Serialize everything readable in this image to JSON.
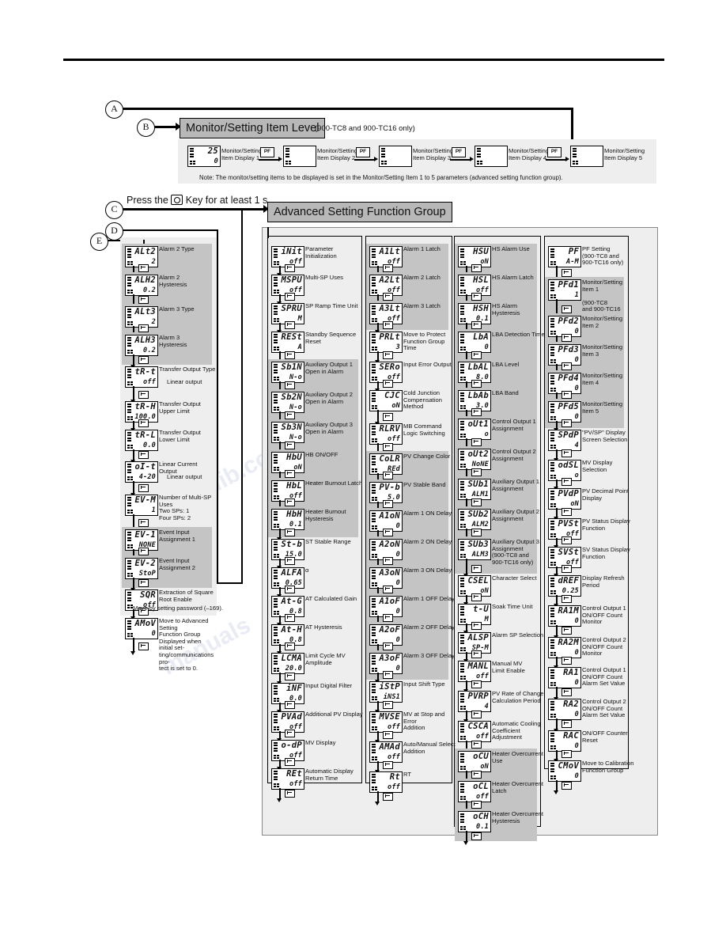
{
  "markers": {
    "a": "A",
    "b": "B",
    "c": "C",
    "d": "D",
    "e": "E"
  },
  "headings": {
    "monitor_level": "Monitor/Setting Item Level",
    "monitor_level_note": "(900-TC8 and 900-TC16 only)",
    "advanced_group": "Advanced Setting Function Group"
  },
  "press_instruction": {
    "pre": "Press the",
    "post": "Key for at least 1 s."
  },
  "monitor_strip": {
    "items": [
      {
        "label": "Monitor/Setting\nItem Display 1",
        "t1": "25",
        "t2": "0"
      },
      {
        "label": "Monitor/Setting\nItem Display 2",
        "t1": "",
        "t2": ""
      },
      {
        "label": "Monitor/Setting\nItem Display 3",
        "t1": "",
        "t2": ""
      },
      {
        "label": "Monitor/Setting\nItem Display 4",
        "t1": "",
        "t2": ""
      },
      {
        "label": "Monitor/Setting\nItem Display 5",
        "t1": "",
        "t2": ""
      }
    ],
    "key_label": "PF",
    "note": "Note: The monitor/setting items to be displayed is set in the Monitor/Setting Item 1 to 5 parameters (advanced setting function group)."
  },
  "column_e": {
    "password_note": "Move by setting password (–169).",
    "items": [
      {
        "t1": "ALt2",
        "t2": "2",
        "label": "Alarm 2 Type",
        "shaded": true
      },
      {
        "t1": "ALH2",
        "t2": "0.2",
        "label": "Alarm 2\nHysteresis",
        "shaded": true
      },
      {
        "t1": "ALt3",
        "t2": "2",
        "label": "Alarm 3 Type",
        "shaded": true
      },
      {
        "t1": "ALH3",
        "t2": "0.2",
        "label": "Alarm 3\nHysteresis",
        "shaded": true
      },
      {
        "t1": "tR-t",
        "t2": "off",
        "label": "Transfer Output Type",
        "extra": "Linear output",
        "shaded": false
      },
      {
        "t1": "tR-H",
        "t2": "100.0",
        "label": "Transfer Output\nUpper Limit",
        "shaded": false
      },
      {
        "t1": "tR-L",
        "t2": "0.0",
        "label": "Transfer Output\nLower Limit",
        "shaded": false
      },
      {
        "t1": "oI-t",
        "t2": "4-20",
        "label": "Linear Current Output",
        "extra": "Linear output",
        "shaded": false
      },
      {
        "t1": "EV-M",
        "t2": "1",
        "label": "Number of Multi-SP Uses\nTwo SPs: 1\nFour SPs: 2",
        "shaded": false
      },
      {
        "t1": "EV-1",
        "t2": "NONE",
        "label": "Event Input\nAssignment 1",
        "shaded": true
      },
      {
        "t1": "EV-2",
        "t2": "StoP",
        "label": "Event Input\nAssignment 2",
        "shaded": true
      },
      {
        "t1": "SQR",
        "t2": "off",
        "label": "Extraction of Square\nRoot Enable",
        "shaded": false
      },
      {
        "t1": "AMoV",
        "t2": "0",
        "label": "Move to Advanced Setting\nFunction Group\nDisplayed when initial set-\nting/communications pro-\ntect is set to 0.",
        "shaded": false
      }
    ]
  },
  "column_1": {
    "items": [
      {
        "t1": "iNit",
        "t2": "off",
        "label": "Parameter Initialization",
        "shaded": false
      },
      {
        "t1": "MSPU",
        "t2": "off",
        "label": "Multi-SP Uses",
        "shaded": false
      },
      {
        "t1": "SPRU",
        "t2": "M",
        "label": "SP Ramp Time Unit",
        "shaded": false
      },
      {
        "t1": "RESt",
        "t2": "A",
        "label": "Standby Sequence\nReset",
        "shaded": false
      },
      {
        "t1": "Sb1N",
        "t2": "N-o",
        "label": "Auxiliary Output 1\nOpen in Alarm",
        "shaded": true
      },
      {
        "t1": "Sb2N",
        "t2": "N-o",
        "label": "Auxiliary Output 2\nOpen in Alarm",
        "shaded": true
      },
      {
        "t1": "Sb3N",
        "t2": "N-o",
        "label": "Auxiliary Output 3\nOpen in Alarm",
        "shaded": true
      },
      {
        "t1": "HbU",
        "t2": "oN",
        "label": "HB ON/OFF",
        "shaded": true
      },
      {
        "t1": "HbL",
        "t2": "off",
        "label": "Heater Burnout Latch",
        "shaded": true
      },
      {
        "t1": "HbH",
        "t2": "0.1",
        "label": "Heater Burnout\nHysteresis",
        "shaded": true
      },
      {
        "t1": "St-b",
        "t2": "15.0",
        "label": "ST Stable Range",
        "shaded": false
      },
      {
        "t1": "ALFA",
        "t2": "0.65",
        "label": "α",
        "shaded": false
      },
      {
        "t1": "At-G",
        "t2": "0.8",
        "label": "AT Calculated Gain",
        "shaded": false
      },
      {
        "t1": "At-H",
        "t2": "0.8",
        "label": "AT Hysteresis",
        "shaded": false
      },
      {
        "t1": "LCMA",
        "t2": "20.0",
        "label": "Limit Cycle MV\nAmplitude",
        "shaded": false
      },
      {
        "t1": "iNF",
        "t2": "0.0",
        "label": "Input Digital Filter",
        "shaded": false
      },
      {
        "t1": "PVAd",
        "t2": "off",
        "label": "Additional PV Display",
        "shaded": false
      },
      {
        "t1": "o-dP",
        "t2": "off",
        "label": "MV Display",
        "shaded": false
      },
      {
        "t1": "REt",
        "t2": "off",
        "label": "Automatic Display\nReturn Time",
        "shaded": false
      }
    ]
  },
  "column_2": {
    "items": [
      {
        "t1": "A1Lt",
        "t2": "off",
        "label": "Alarm 1 Latch",
        "shaded": true
      },
      {
        "t1": "A2Lt",
        "t2": "off",
        "label": "Alarm 2 Latch",
        "shaded": true
      },
      {
        "t1": "A3Lt",
        "t2": "off",
        "label": "Alarm 3 Latch",
        "shaded": true
      },
      {
        "t1": "PRLt",
        "t2": "3",
        "label": "Move to Protect\nFunction Group Time",
        "shaded": false
      },
      {
        "t1": "SERo",
        "t2": "off",
        "label": "Input Error Output",
        "shaded": false
      },
      {
        "t1": "CJC",
        "t2": "oN",
        "label": "Cold Junction\nCompensation\nMethod",
        "shaded": false
      },
      {
        "t1": "RLRV",
        "t2": "off",
        "label": "MB Command\nLogic Switching",
        "shaded": false
      },
      {
        "t1": "CoLR",
        "t2": "REd",
        "label": "PV Change Color",
        "shaded": true
      },
      {
        "t1": "PV-b",
        "t2": "5.0",
        "label": "PV Stable Band",
        "shaded": true
      },
      {
        "t1": "A1oN",
        "t2": "0",
        "label": "Alarm 1 ON Delay",
        "shaded": true
      },
      {
        "t1": "A2oN",
        "t2": "0",
        "label": "Alarm 2 ON Delay",
        "shaded": true
      },
      {
        "t1": "A3oN",
        "t2": "0",
        "label": "Alarm 3 ON Delay",
        "shaded": true
      },
      {
        "t1": "A1oF",
        "t2": "0",
        "label": "Alarm 1 OFF Delay",
        "shaded": true
      },
      {
        "t1": "A2oF",
        "t2": "0",
        "label": "Alarm 2 OFF Delay",
        "shaded": true
      },
      {
        "t1": "A3oF",
        "t2": "0",
        "label": "Alarm 3 OFF Delay",
        "shaded": true
      },
      {
        "t1": "iStP",
        "t2": "iNS1",
        "label": "Input Shift Type",
        "shaded": false
      },
      {
        "t1": "MVSE",
        "t2": "off",
        "label": "MV at Stop and Error\nAddition",
        "shaded": false
      },
      {
        "t1": "AMAd",
        "t2": "off",
        "label": "Auto/Manual Select\nAddition",
        "shaded": false
      },
      {
        "t1": "Rt",
        "t2": "off",
        "label": "RT",
        "shaded": false
      }
    ]
  },
  "column_3": {
    "items": [
      {
        "t1": "HSU",
        "t2": "oN",
        "label": "HS Alarm Use",
        "shaded": true
      },
      {
        "t1": "HSL",
        "t2": "off",
        "label": "HS Alarm Latch",
        "shaded": true
      },
      {
        "t1": "HSH",
        "t2": "0.1",
        "label": "HS Alarm Hysteresis",
        "shaded": true
      },
      {
        "t1": "LbA",
        "t2": "0",
        "label": "LBA Detection Time",
        "shaded": true
      },
      {
        "t1": "LbAL",
        "t2": "8.0",
        "label": "LBA Level",
        "shaded": true
      },
      {
        "t1": "LbAb",
        "t2": "3.0",
        "label": "LBA Band",
        "shaded": true
      },
      {
        "t1": "oUt1",
        "t2": "o",
        "label": "Control Output 1\nAssignment",
        "shaded": true
      },
      {
        "t1": "oUt2",
        "t2": "NoNE",
        "label": "Control Output 2\nAssignment",
        "shaded": true
      },
      {
        "t1": "SUb1",
        "t2": "ALM1",
        "label": "Auxiliary Output 1\nAssignment",
        "shaded": true
      },
      {
        "t1": "SUb2",
        "t2": "ALM2",
        "label": "Auxiliary Output 2\nAssignment",
        "shaded": true
      },
      {
        "t1": "SUb3",
        "t2": "ALM3",
        "label": "Auxiliary Output 3\nAssignment\n(900-TC8 and\n900-TC16 only)",
        "shaded": true
      },
      {
        "t1": "CSEL",
        "t2": "oN",
        "label": "Character Select",
        "shaded": false
      },
      {
        "t1": "t-U",
        "t2": "M",
        "label": "Soak Time Unit",
        "shaded": false
      },
      {
        "t1": "ALSP",
        "t2": "SP-M",
        "label": "Alarm SP Selection",
        "shaded": false
      },
      {
        "t1": "MANL",
        "t2": "off",
        "label": "Manual MV\nLimit Enable",
        "shaded": false
      },
      {
        "t1": "PVRP",
        "t2": "4",
        "label": "PV Rate of Change\nCalculation Period",
        "shaded": false
      },
      {
        "t1": "CSCA",
        "t2": "off",
        "label": "Automatic Cooling\nCoefficient Adjustment",
        "shaded": false
      },
      {
        "t1": "oCU",
        "t2": "oN",
        "label": "Heater Overcurrent\nUse",
        "shaded": true
      },
      {
        "t1": "oCL",
        "t2": "off",
        "label": "Heater Overcurrent\nLatch",
        "shaded": true
      },
      {
        "t1": "oCH",
        "t2": "0.1",
        "label": "Heater Overcurrent\nHysteresis",
        "shaded": true
      }
    ]
  },
  "column_4": {
    "items": [
      {
        "t1": "PF",
        "t2": "A-M",
        "label": "PF Setting\n(900-TC8 and\n900-TC16 only)",
        "shaded": false
      },
      {
        "t1": "PFd1",
        "t2": "1",
        "label": "Monitor/Setting Item 1\n\n(900-TC8\nand 900-TC16  only)",
        "shaded": true
      },
      {
        "t1": "PFd2",
        "t2": "0",
        "label": "Monitor/Setting Item 2",
        "shaded": true
      },
      {
        "t1": "PFd3",
        "t2": "0",
        "label": "Monitor/Setting Item 3",
        "shaded": true
      },
      {
        "t1": "PFd4",
        "t2": "0",
        "label": "Monitor/Setting Item 4",
        "shaded": true
      },
      {
        "t1": "PFd5",
        "t2": "0",
        "label": "Monitor/Setting Item 5",
        "shaded": true
      },
      {
        "t1": "SPdP",
        "t2": "4",
        "label": "\"PV/SP\" Display\nScreen Selection",
        "shaded": false
      },
      {
        "t1": "odSL",
        "t2": "o",
        "label": "MV Display Selection",
        "shaded": false
      },
      {
        "t1": "PVdP",
        "t2": "oN",
        "label": "PV Decimal Point\nDisplay",
        "shaded": false
      },
      {
        "t1": "PVSt",
        "t2": "off",
        "label": "PV Status Display\nFunction",
        "shaded": false
      },
      {
        "t1": "SVSt",
        "t2": "off",
        "label": "SV Status Display\nFunction",
        "shaded": false
      },
      {
        "t1": "dREF",
        "t2": "0.25",
        "label": "Display Refresh\nPeriod",
        "shaded": false
      },
      {
        "t1": "RA1M",
        "t2": "0",
        "label": "Control Output 1\nON/OFF Count\nMonitor",
        "shaded": false
      },
      {
        "t1": "RA2M",
        "t2": "0",
        "label": "Control Output 2\nON/OFF Count\nMonitor",
        "shaded": false
      },
      {
        "t1": "RA1",
        "t2": "0",
        "label": "Control Output 1\nON/OFF Count\nAlarm Set Value",
        "shaded": false
      },
      {
        "t1": "RA2",
        "t2": "0",
        "label": "Control Output 2\nON/OFF Count\nAlarm Set Value",
        "shaded": false
      },
      {
        "t1": "RAC",
        "t2": "0",
        "label": "ON/OFF Counter\nReset",
        "shaded": false
      },
      {
        "t1": "CMoV",
        "t2": "0",
        "label": "Move to Calibration\nFunction Group",
        "shaded": false
      }
    ]
  },
  "watermarks": [
    "manualslib.com",
    "manuals"
  ]
}
